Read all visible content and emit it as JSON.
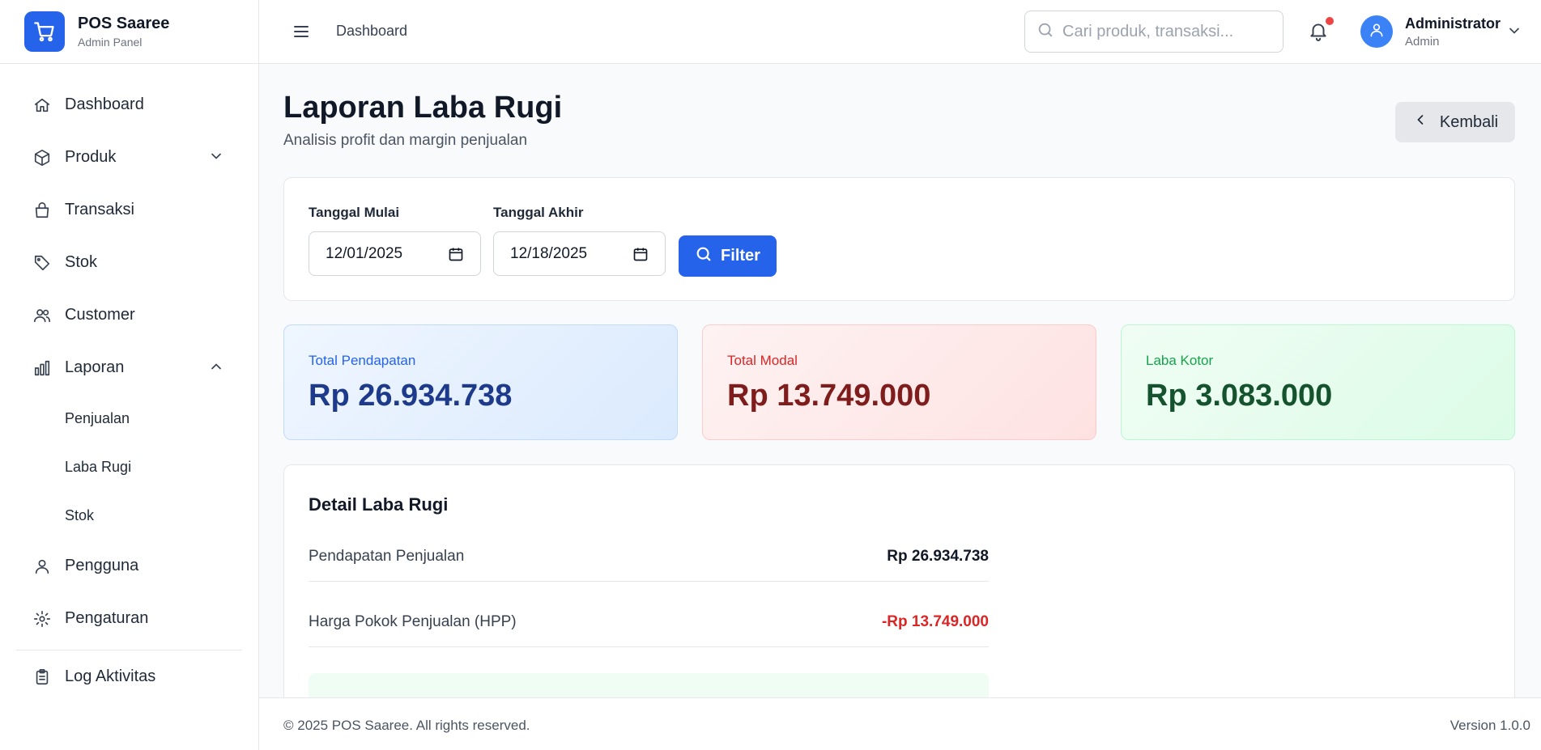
{
  "brand": {
    "name": "POS Saaree",
    "subtitle": "Admin Panel"
  },
  "sidebar": {
    "items": [
      {
        "label": "Dashboard",
        "icon": "home-icon"
      },
      {
        "label": "Produk",
        "icon": "box-icon",
        "expandable": true,
        "expanded": false
      },
      {
        "label": "Transaksi",
        "icon": "shopping-bag-icon"
      },
      {
        "label": "Stok",
        "icon": "tag-icon"
      },
      {
        "label": "Customer",
        "icon": "users-icon"
      },
      {
        "label": "Laporan",
        "icon": "bar-chart-icon",
        "expandable": true,
        "expanded": true
      },
      {
        "label": "Pengguna",
        "icon": "user-icon"
      },
      {
        "label": "Pengaturan",
        "icon": "gear-icon"
      },
      {
        "label": "Log Aktivitas",
        "icon": "clipboard-icon"
      }
    ],
    "laporan_sub": [
      "Penjualan",
      "Laba Rugi",
      "Stok"
    ]
  },
  "topbar": {
    "breadcrumb": "Dashboard",
    "search_placeholder": "Cari produk, transaksi...",
    "user_name": "Administrator",
    "user_role": "Admin",
    "notification_dot_color": "#ef4444"
  },
  "page": {
    "title": "Laporan Laba Rugi",
    "subtitle": "Analisis profit dan margin penjualan",
    "back_label": "Kembali"
  },
  "filter": {
    "start_label": "Tanggal Mulai",
    "start_value": "12/01/2025",
    "end_label": "Tanggal Akhir",
    "end_value": "12/18/2025",
    "button_label": "Filter"
  },
  "stats": [
    {
      "label": "Total Pendapatan",
      "value": "Rp 26.934.738",
      "color": "#2563eb"
    },
    {
      "label": "Total Modal",
      "value": "Rp 13.749.000",
      "color": "#dc2626"
    },
    {
      "label": "Laba Kotor",
      "value": "Rp 3.083.000",
      "color": "#16a34a"
    }
  ],
  "detail": {
    "title": "Detail Laba Rugi",
    "rows": [
      {
        "label": "Pendapatan Penjualan",
        "value": "Rp 26.934.738"
      },
      {
        "label": "Harga Pokok Penjualan (HPP)",
        "value": "-Rp 13.749.000"
      }
    ]
  },
  "footer": {
    "copyright": "© 2025 POS Saaree. All rights reserved.",
    "version": "Version 1.0.0"
  },
  "colors": {
    "primary": "#2563eb",
    "sidebar_bg": "#ffffff",
    "page_bg": "#f8fafc"
  }
}
